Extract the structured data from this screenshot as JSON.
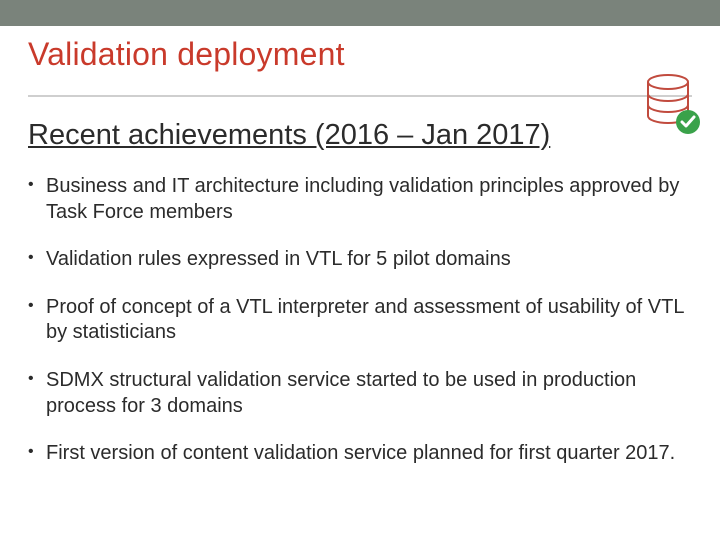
{
  "title": "Validation deployment",
  "subtitle": "Recent achievements (2016 – Jan 2017)",
  "bullets": [
    "Business and IT architecture including validation principles approved by Task Force members",
    "Validation rules expressed in VTL for 5 pilot domains",
    "Proof of concept of a VTL interpreter and assessment of usability of VTL by statisticians",
    "SDMX structural validation service started to be used in production process for 3 domains",
    "First version of content validation service planned for first quarter 2017."
  ],
  "icon": {
    "name": "database-check-icon",
    "db_color": "#c14b3e",
    "check_bg": "#3aa24a",
    "check_fg": "#ffffff"
  }
}
